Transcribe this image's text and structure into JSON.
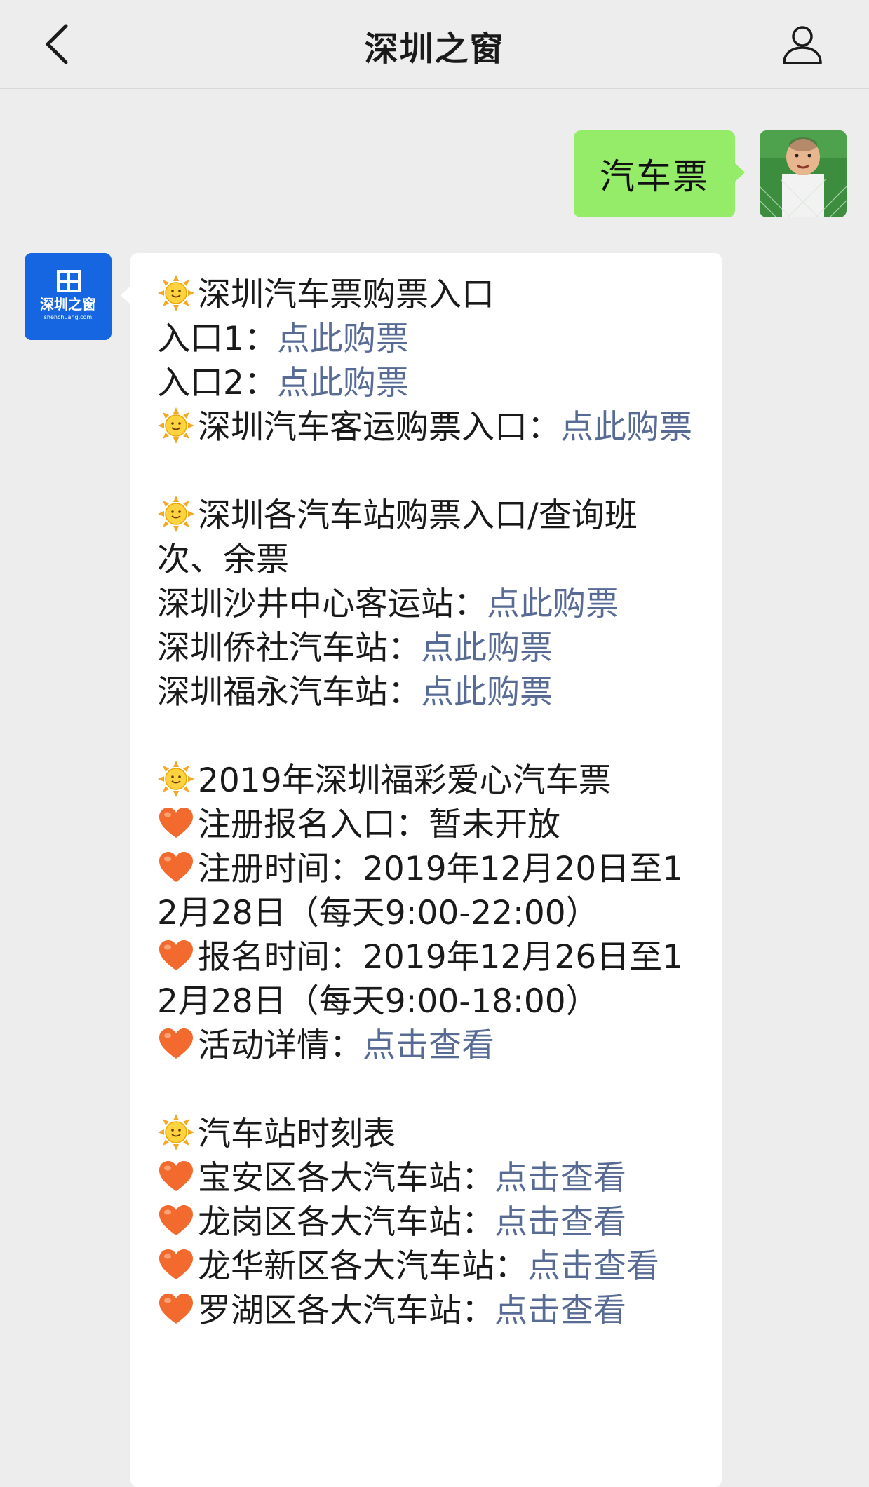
{
  "navbar": {
    "title": "深圳之窗"
  },
  "user_message": {
    "text": "汽车票"
  },
  "bot_avatar": {
    "brand_text": "深圳之窗",
    "brand_sub": "shenchuang.com"
  },
  "bot_message": {
    "section1": {
      "heading": "深圳汽车票购票入口",
      "entry1_label": "入口1：",
      "entry1_link": "点此购票",
      "entry2_label": "入口2：",
      "entry2_link": "点此购票",
      "passenger_label": "深圳汽车客运购票入口：",
      "passenger_link": "点此购票"
    },
    "section2": {
      "heading": "深圳各汽车站购票入口/查询班次、余票",
      "stations": [
        {
          "label": "深圳沙井中心客运站：",
          "link": "点此购票"
        },
        {
          "label": "深圳侨社汽车站：",
          "link": "点此购票"
        },
        {
          "label": "深圳福永汽车站：",
          "link": "点此购票"
        }
      ]
    },
    "section3": {
      "heading": "2019年深圳福彩爱心汽车票",
      "register_entry": "注册报名入口：暂未开放",
      "register_time": "注册时间：2019年12月20日至12月28日（每天9:00-22:00）",
      "signup_time": "报名时间：2019年12月26日至12月28日（每天9:00-18:00）",
      "details_label": "活动详情：",
      "details_link": "点击查看"
    },
    "section4": {
      "heading": "汽车站时刻表",
      "districts": [
        {
          "label": "宝安区各大汽车站：",
          "link": "点击查看"
        },
        {
          "label": "龙岗区各大汽车站：",
          "link": "点击查看"
        },
        {
          "label": "龙华新区各大汽车站：",
          "link": "点击查看"
        },
        {
          "label": "罗湖区各大汽车站：",
          "link": "点击查看"
        }
      ]
    }
  },
  "icons": {
    "back": "chevron-left-icon",
    "profile": "person-icon",
    "section_marker": "sun-emoji-icon",
    "item_marker": "heart-emoji-icon"
  },
  "colors": {
    "link": "#576b95",
    "user_bubble": "#95ec69",
    "bot_avatar_bg": "#1566e0",
    "background": "#ededed"
  }
}
